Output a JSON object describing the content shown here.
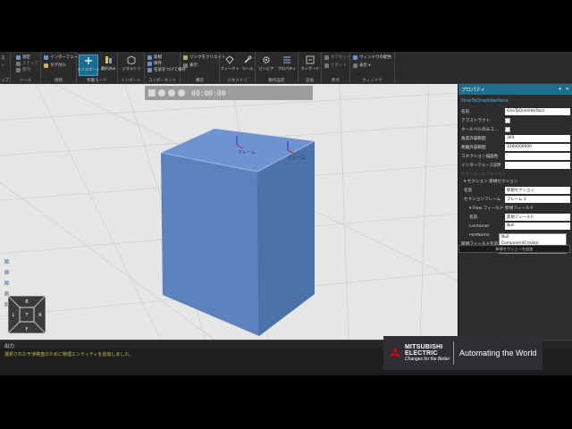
{
  "ribbon": {
    "groups": [
      {
        "label": "ップ",
        "items": [
          {
            "label": "ス",
            "dim": false
          },
          {
            "label": "ャ",
            "dim": true
          }
        ]
      },
      {
        "label": "ツール",
        "items": [
          {
            "label": "測定",
            "dim": false
          },
          {
            "label": "スナップ",
            "dim": true
          },
          {
            "label": "整列",
            "dim": true
          }
        ]
      },
      {
        "label": "接続",
        "items": [
          {
            "label": "インターフェース",
            "dim": false
          },
          {
            "label": "タグ付ル",
            "dim": false
          }
        ]
      },
      {
        "label": "移動モード",
        "big": [
          {
            "label": "エミスポート",
            "active": true
          },
          {
            "label": "選択済み",
            "active": false
          }
        ]
      },
      {
        "label": "インポート",
        "big": [
          {
            "label": "ジオメトリ",
            "active": false
          }
        ]
      },
      {
        "label": "コンポーネント",
        "items": [
          {
            "label": "新規",
            "dim": false
          },
          {
            "label": "保存",
            "dim": false
          },
          {
            "label": "名前をつけて保存",
            "dim": false
          }
        ]
      },
      {
        "label": "構造",
        "items": [
          {
            "label": "リンクをクリエイト",
            "dim": false
          },
          {
            "label": "表示",
            "dim": false
          }
        ]
      },
      {
        "label": "ジオメトリ",
        "big": [
          {
            "label": "フィーチャ",
            "active": false
          },
          {
            "label": "ツール",
            "active": false
          }
        ]
      },
      {
        "label": "動作設定",
        "big": [
          {
            "label": "ビヘビア",
            "active": false
          },
          {
            "label": "プロパティ",
            "active": false
          }
        ]
      },
      {
        "label": "追加",
        "big": [
          {
            "label": "ウィザード",
            "active": false
          }
        ]
      },
      {
        "label": "原点",
        "items": [
          {
            "label": "オフセット",
            "dim": true
          },
          {
            "label": "ピボット",
            "dim": true
          }
        ]
      },
      {
        "label": "ウィンドウ",
        "items": [
          {
            "label": "ウィンドウの配色",
            "dim": false
          },
          {
            "label": "表示 ▾",
            "dim": false
          }
        ]
      }
    ]
  },
  "viewport": {
    "time": "00:00:00",
    "frame_labels": [
      "フレーム",
      "フレーム"
    ]
  },
  "navcube": {
    "top": "B",
    "left": "L",
    "center_t": "T",
    "right": "R",
    "bottom": "F"
  },
  "properties": {
    "header": "プロパティ",
    "pin": "✦",
    "close": "✕",
    "object_name": "OneToOneInterface",
    "rows": [
      {
        "label": "名前",
        "value": "OneToOneInterface",
        "type": "text"
      },
      {
        "label": "アブストラクト",
        "value": "",
        "type": "check"
      },
      {
        "label": "ホールベルのみコ...",
        "value": "",
        "type": "check"
      },
      {
        "label": "角度許容範囲",
        "value": "360",
        "type": "text"
      },
      {
        "label": "距離許容範囲",
        "value": "1000000000",
        "type": "text"
      },
      {
        "label": "コネクション描画色",
        "value": "",
        "type": "text"
      },
      {
        "label": "インターフェース説明",
        "value": "",
        "type": "text"
      }
    ],
    "section_fields": "セクションとフィールド",
    "section_new": "▾ セクション 新規セクション",
    "section_rows": [
      {
        "label": "名前",
        "value": "新規セクション"
      },
      {
        "label": "セクションフレーム",
        "value": "フレーム 1"
      }
    ],
    "flow_field": "▾ Flow フィールド 新規フィールド",
    "flow_rows": [
      {
        "label": "名前",
        "value": "新規フィールド"
      },
      {
        "label": "Container",
        "value": "Null"
      },
      {
        "label": "PortName",
        "value": ""
      }
    ],
    "dropdown_options": [
      "Null",
      "ComponentCreator",
      "Checkbox..."
    ],
    "add_field_label": "新規フィールドを追加",
    "add_button": "新規セクションを追加"
  },
  "output": {
    "title": "出力",
    "message": "選択された干渉検査のために物理エンティティを追加しました。"
  },
  "logo": {
    "brand1": "MITSUBISHI",
    "brand2": "ELECTRIC",
    "tagline": "Changes for the Better",
    "slogan": "Automating the World"
  },
  "colors": {
    "cube_front": "#5b82bd",
    "cube_top": "#6f93cf",
    "cube_side": "#4d72aa",
    "accent": "#1c6e8c"
  }
}
